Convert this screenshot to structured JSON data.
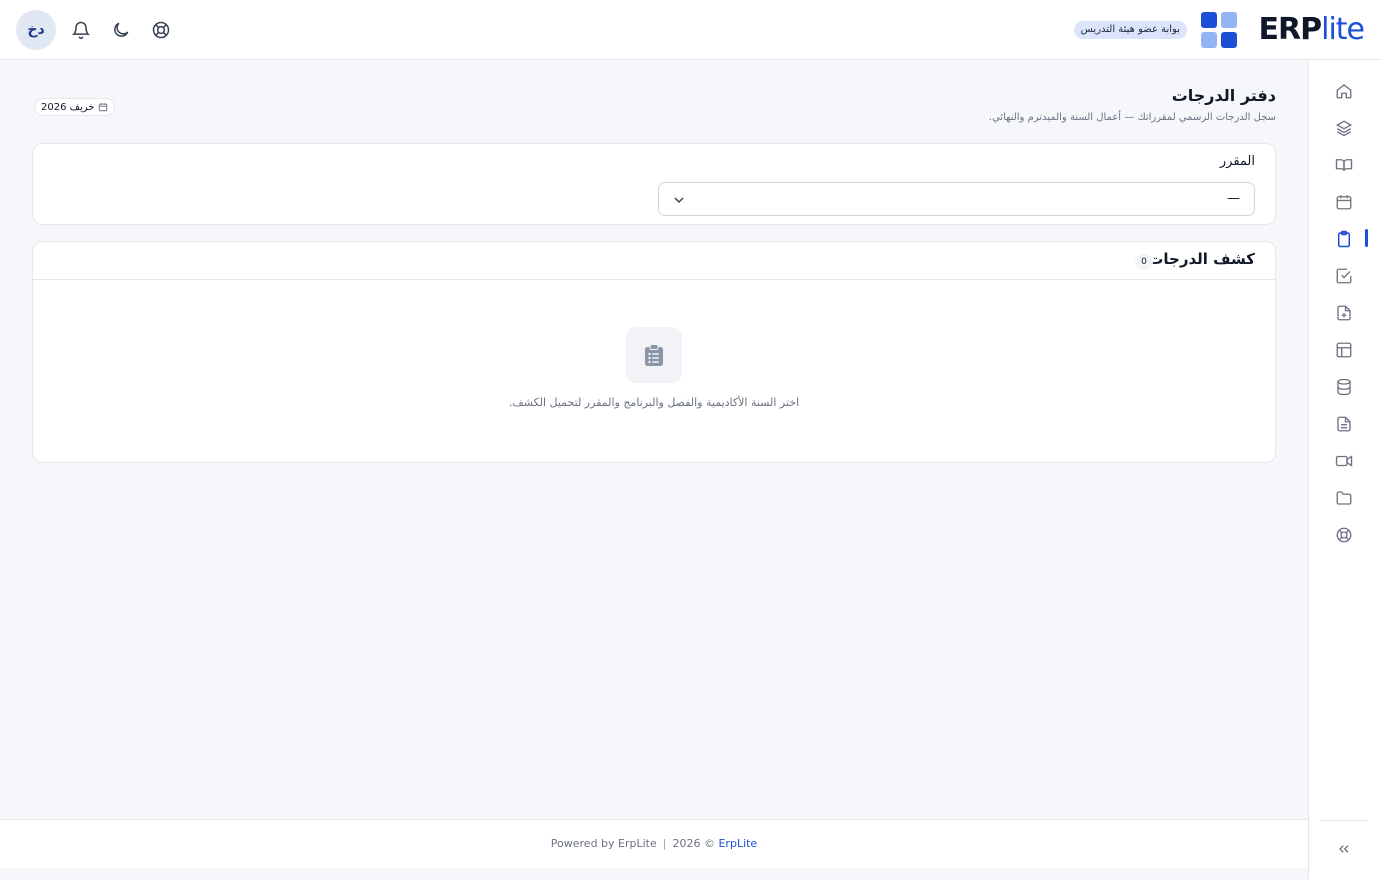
{
  "header": {
    "brand_main": "ERP",
    "brand_accent": "lite",
    "portal_badge": "بوابة عضو هيئة التدريس",
    "avatar_initials": "دخ",
    "logo_colors": [
      "#1d4ed8",
      "#93b4f5",
      "#93b4f5",
      "#1d4ed8"
    ],
    "icons": [
      "help-icon",
      "moon-icon",
      "bell-icon"
    ]
  },
  "sidebar": {
    "items": [
      {
        "icon": "home-icon"
      },
      {
        "icon": "layers-icon"
      },
      {
        "icon": "book-icon"
      },
      {
        "icon": "calendar-icon"
      },
      {
        "icon": "clipboard-icon",
        "active": true
      },
      {
        "icon": "check-square-icon"
      },
      {
        "icon": "file-plus-icon"
      },
      {
        "icon": "layout-icon"
      },
      {
        "icon": "database-icon"
      },
      {
        "icon": "file-text-icon"
      },
      {
        "icon": "video-icon"
      },
      {
        "icon": "folder-icon"
      },
      {
        "icon": "lifebuoy-icon"
      }
    ],
    "collapse_icon": "chevrons-left-icon"
  },
  "page": {
    "title": "دفتر الدرجات",
    "subtitle": "سجل الدرجات الرسمي لمقرراتك — أعمال السنة والميدترم والنهائي.",
    "term": "خريف 2026"
  },
  "course_filter": {
    "label": "المقرر",
    "selected": "—"
  },
  "grades": {
    "title": "كشف الدرجات",
    "count": "0",
    "empty_message": "اختر السنة الأكاديمية والفصل والبرنامج والمقرر لتحميل الكشف."
  },
  "footer": {
    "brand_link": "ErpLite",
    "copyright": "2026 ©",
    "separator": "|",
    "powered": "Powered by ErpLite"
  },
  "colors": {
    "accent": "#1d4ed8",
    "background": "#f5f7fb",
    "border": "#e5e7eb"
  }
}
